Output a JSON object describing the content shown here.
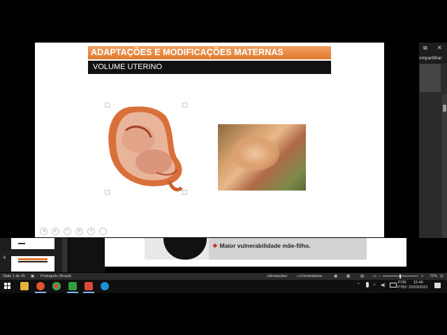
{
  "slide": {
    "title": "ADAPTAÇÕES E MODIFICAÇÕES MATERNAS",
    "subtitle": "VOLUME UTERINO",
    "lower_text": "Maior vulnerabilidade mãe-filho.",
    "lower_bullet": "❖"
  },
  "right_pane": {
    "share_label": "ompartilhar",
    "minimize": "⧉",
    "close": "✕"
  },
  "thumbnails": {
    "slide_number": "6"
  },
  "status_bar": {
    "slide_indicator": "Slide 1 de 41",
    "language": "Português (Brasil)",
    "notes": "Anotações",
    "comments": "Comentários",
    "zoom": "72%"
  },
  "taskbar": {
    "lang_top": "POR",
    "lang_bottom": "PTB2",
    "time": "15:48",
    "date": "22/03/2021"
  },
  "colors": {
    "title_bar": "#e07a2e",
    "subtitle_bar": "#111111",
    "taskbar": "#101010"
  }
}
